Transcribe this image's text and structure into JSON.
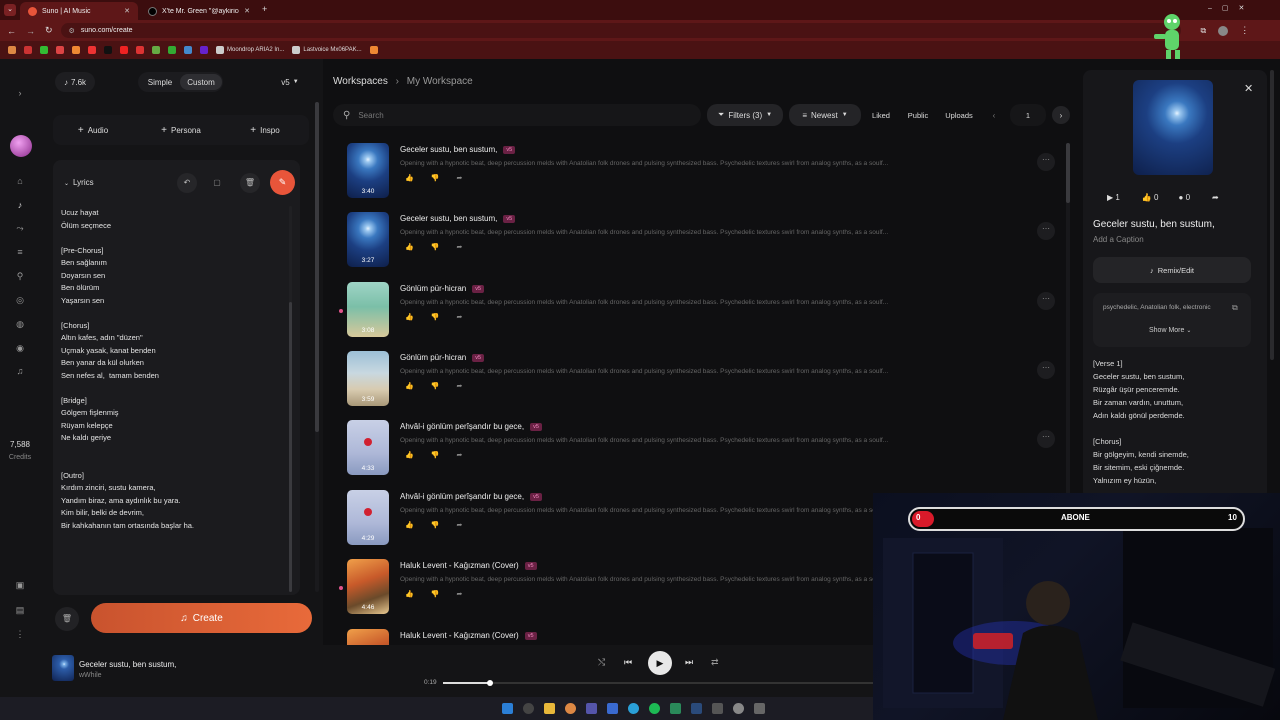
{
  "browser": {
    "tabs": [
      {
        "title": "Suno | AI Music",
        "active": true
      },
      {
        "title": "X'te Mr. Green \"@aykiricomtr"
      }
    ],
    "url": "suno.com/create",
    "bookmarks": [
      "Moondrop ARIA2 In...",
      "Lastvoice Mx06PAK..."
    ]
  },
  "sidebar": {
    "credits_value": "7,588",
    "credits_label": "Credits"
  },
  "create_panel": {
    "credits_chip": "7.6k",
    "mode_simple": "Simple",
    "mode_custom": "Custom",
    "model": "v5",
    "add_audio": "Audio",
    "add_persona": "Persona",
    "add_inspo": "Inspo",
    "lyrics_label": "Lyrics",
    "lyrics_text": "Ucuz hayat\nÖlüm seçmece\n\n[Pre-Chorus]\nBen sağlanım\nDoyarsın sen\nBen ölürüm\nYaşarsın sen\n\n[Chorus]\nAltın kafes, adın \"düzen\"\nUçmak yasak, kanat benden\nBen yanar da kül olurken\nSen nefes al,  tamam benden\n\n[Bridge]\nGölgem fişlenmiş\nRüyam kelepçe\nNe kaldı geriye\n\n\n[Outro]\nKırdım zinciri, sustu kamera,\nYandım biraz, ama aydınlık bu yara.\nKim bilir, belki de devrim,\nBir kahkahanın tam ortasında başlar ha.",
    "create_button": "Create"
  },
  "workspace": {
    "breadcrumb_root": "Workspaces",
    "breadcrumb_current": "My Workspace",
    "search_placeholder": "Search",
    "filters": "Filters (3)",
    "sort": "Newest",
    "tabs": [
      "Liked",
      "Public",
      "Uploads"
    ],
    "page": "1",
    "songs": [
      {
        "title": "Geceler sustu, ben sustum,",
        "badge": "v5",
        "duration": "3:40",
        "desc": "Opening with a hypnotic beat, deep percussion melds with Anatolian folk drones and pulsing synthesized bass. Psychedelic textures swirl from analog synths, as a soulf...",
        "art": "blue-sun"
      },
      {
        "title": "Geceler sustu, ben sustum,",
        "badge": "v5",
        "duration": "3:27",
        "desc": "Opening with a hypnotic beat, deep percussion melds with Anatolian folk drones and pulsing synthesized bass. Psychedelic textures swirl from analog synths, as a soulf...",
        "art": "blue-sun"
      },
      {
        "title": "Gönlüm pür-hicran",
        "badge": "v5",
        "duration": "3:08",
        "desc": "Opening with a hypnotic beat, deep percussion melds with Anatolian folk drones and pulsing synthesized bass. Psychedelic textures swirl from analog synths, as a soulf...",
        "art": "teal"
      },
      {
        "title": "Gönlüm pür-hicran",
        "badge": "v5",
        "duration": "3:59",
        "desc": "Opening with a hypnotic beat, deep percussion melds with Anatolian folk drones and pulsing synthesized bass. Psychedelic textures swirl from analog synths, as a soulf...",
        "art": "desert"
      },
      {
        "title": "Ahvâl-i gönlüm perîşandır bu gece,",
        "badge": "v5",
        "duration": "4:33",
        "desc": "Opening with a hypnotic beat, deep percussion melds with Anatolian folk drones and pulsing synthesized bass. Psychedelic textures swirl from analog synths, as a soulf...",
        "art": "rose"
      },
      {
        "title": "Ahvâl-i gönlüm perîşandır bu gece,",
        "badge": "v5",
        "duration": "4:29",
        "desc": "Opening with a hypnotic beat, deep percussion melds with Anatolian folk drones and pulsing synthesized bass. Psychedelic textures swirl from analog synths, as a soulf...",
        "art": "rose"
      },
      {
        "title": "Haluk Levent - Kağızman (Cover)",
        "badge": "v5",
        "duration": "4:46",
        "desc": "Opening with a hypnotic beat, deep percussion melds with Anatolian folk drones and pulsing synthesized bass. Psychedelic textures swirl from analog synths, as a soulf...",
        "art": "autumn"
      },
      {
        "title": "Haluk Levent - Kağızman (Cover)",
        "badge": "v5",
        "duration": "",
        "desc": "",
        "art": "autumn"
      }
    ]
  },
  "detail": {
    "plays": "1",
    "likes": "0",
    "comments": "0",
    "title": "Geceler sustu, ben sustum,",
    "caption": "Add a Caption",
    "remix": "Remix/Edit",
    "tags": "psychedelic, Anatolian folk, electronic",
    "show_more": "Show More",
    "lyrics": "[Verse 1]\nGeceler sustu, ben sustum,\nRüzgâr üşür penceremde.\nBir zaman vardın, unuttum,\nAdın kaldı gönül perdemde.\n\n[Chorus]\nBir gölgeyim, kendi sinemde,\nBir sitemim, eski çiğnemde.\nYalnızım ey hüzün,"
  },
  "player": {
    "title": "Geceler sustu, ben sustum,",
    "artist": "wWhile",
    "elapsed": "0:19",
    "progress": 0.11
  },
  "overlay": {
    "left_value": "0",
    "label": "ABONE",
    "right_value": "10"
  },
  "colors": {
    "accent": "#e8553a",
    "badge": "#f08ac0",
    "tab_bar": "#3c0d0e"
  }
}
